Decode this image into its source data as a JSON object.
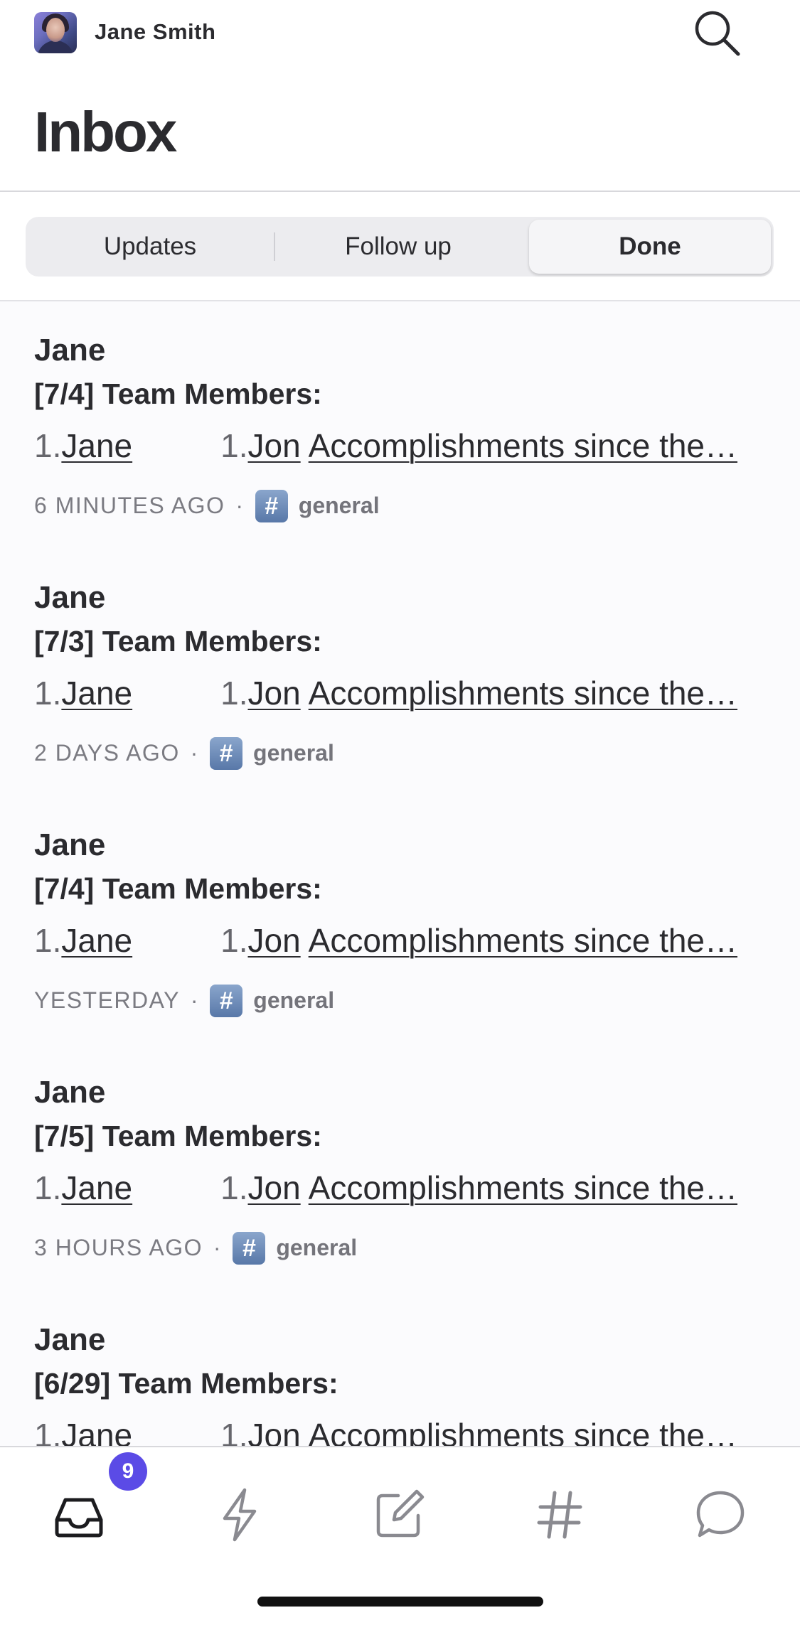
{
  "header": {
    "user_name": "Jane Smith",
    "avatar_icon": "user-avatar",
    "search_icon": "search-icon"
  },
  "page": {
    "title": "Inbox"
  },
  "segments": {
    "items": [
      "Updates",
      "Follow up",
      "Done"
    ],
    "selected": "Done"
  },
  "feed": [
    {
      "author": "Jane",
      "subject": "[7/4] Team Members:",
      "preview": {
        "num1": "1.",
        "link1": "Jane",
        "num2": "1.",
        "link2": "Jon",
        "rest": "Accomplishments since the…"
      },
      "time": "6 MINUTES AGO",
      "sep": "·",
      "channel_icon": "#",
      "channel": "general"
    },
    {
      "author": "Jane",
      "subject": "[7/3] Team Members:",
      "preview": {
        "num1": "1.",
        "link1": "Jane",
        "num2": "1.",
        "link2": "Jon",
        "rest": "Accomplishments since the…"
      },
      "time": "2 DAYS AGO",
      "sep": "·",
      "channel_icon": "#",
      "channel": "general"
    },
    {
      "author": "Jane",
      "subject": "[7/4] Team Members:",
      "preview": {
        "num1": "1.",
        "link1": "Jane",
        "num2": "1.",
        "link2": "Jon",
        "rest": "Accomplishments since the…"
      },
      "time": "YESTERDAY",
      "sep": "·",
      "channel_icon": "#",
      "channel": "general"
    },
    {
      "author": "Jane",
      "subject": "[7/5] Team Members:",
      "preview": {
        "num1": "1.",
        "link1": "Jane",
        "num2": "1.",
        "link2": "Jon",
        "rest": "Accomplishments since the…"
      },
      "time": "3 HOURS AGO",
      "sep": "·",
      "channel_icon": "#",
      "channel": "general"
    },
    {
      "author": "Jane",
      "subject": "[6/29] Team Members:",
      "preview": {
        "num1": "1.",
        "link1": "Jane",
        "num2": "1.",
        "link2": "Jon",
        "rest": "Accomplishments since the…"
      },
      "time": "",
      "sep": "",
      "channel_icon": "",
      "channel": ""
    }
  ],
  "tabbar": {
    "tabs": [
      "inbox-icon",
      "activity-bolt-icon",
      "compose-icon",
      "channels-hash-icon",
      "messages-icon"
    ],
    "inbox_badge": "9",
    "accent_color": "#5b4be6"
  }
}
